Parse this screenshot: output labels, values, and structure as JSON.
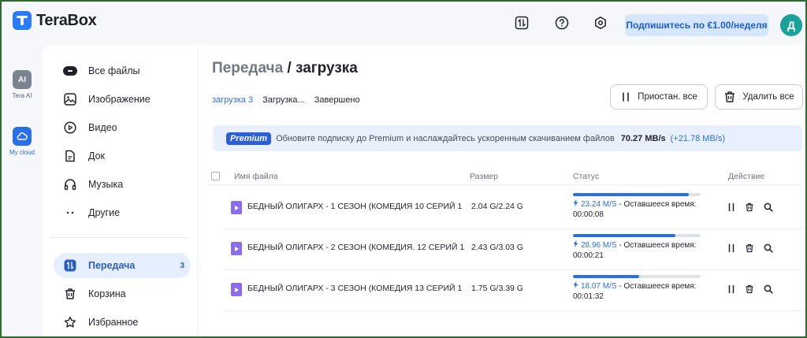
{
  "app": {
    "logo_text": "TeraBox",
    "subscribe_label": "Подпишитесь по €1.00/неделя",
    "avatar_letter": "Д"
  },
  "rail": {
    "items": [
      {
        "label": "Tera AI",
        "icon_text": "AI"
      },
      {
        "label": "My cloud"
      }
    ]
  },
  "sidebar": {
    "items": [
      {
        "label": "Все файлы"
      },
      {
        "label": "Изображение"
      },
      {
        "label": "Видео"
      },
      {
        "label": "Док"
      },
      {
        "label": "Музыка"
      },
      {
        "label": "Другие"
      },
      {
        "label": "Передача",
        "badge": "3"
      },
      {
        "label": "Корзина"
      },
      {
        "label": "Избранное"
      }
    ]
  },
  "main": {
    "title_crumb": "Передача",
    "title_sep": " / ",
    "title_current": "загрузка",
    "tabs": [
      {
        "label": "загрузка 3"
      },
      {
        "label": "Загрузка..."
      },
      {
        "label": "Завершено"
      }
    ],
    "pause_all_label": "Приостан. все",
    "delete_all_label": "Удалить все",
    "banner": {
      "badge": "Premium",
      "text": "Обновите подписку до Premium и наслаждайтесь ускоренным скачиванием файлов",
      "speed": "70.27 MB/s",
      "delta": "(+21.78 MB/s)"
    },
    "columns": {
      "name": "Имя файла",
      "size": "Размер",
      "status": "Статус",
      "action": "Действие"
    },
    "rows": [
      {
        "name": "БЕДНЫЙ ОЛИГАРХ - 1 СЕЗОН (КОМЕДИЯ 10 СЕРИЙ 1 ...",
        "size": "2.04 G/2.24 G",
        "progress": 0.91,
        "rate": "23.24 M/S",
        "remaining_label": " - Оставшееся время:",
        "remaining": "00:00:08"
      },
      {
        "name": "БЕДНЫЙ ОЛИГАРХ - 2 СЕЗОН (КОМЕДИЯ. 12 СЕРИЙ 1 ...",
        "size": "2.43 G/3.03 G",
        "progress": 0.8,
        "rate": "28.96 M/S",
        "remaining_label": " - Оставшееся время:",
        "remaining": "00:00:21"
      },
      {
        "name": "БЕДНЫЙ ОЛИГАРХ - 3 СЕЗОН (КОМЕДИЯ 13 СЕРИЙ 1 ...",
        "size": "1.75 G/3.39 G",
        "progress": 0.52,
        "rate": "18.07 M/S",
        "remaining_label": " - Оставшееся время:",
        "remaining": "00:01:32"
      }
    ]
  },
  "colors": {
    "accent": "#2b6fe8",
    "avatar": "#1aa29a",
    "frame": "#2f6b2f"
  },
  "icons": [
    "transfer-icon",
    "help-icon",
    "settings-icon",
    "pause-icon",
    "trash-icon",
    "search-icon",
    "video-file-icon",
    "bolt-icon"
  ]
}
